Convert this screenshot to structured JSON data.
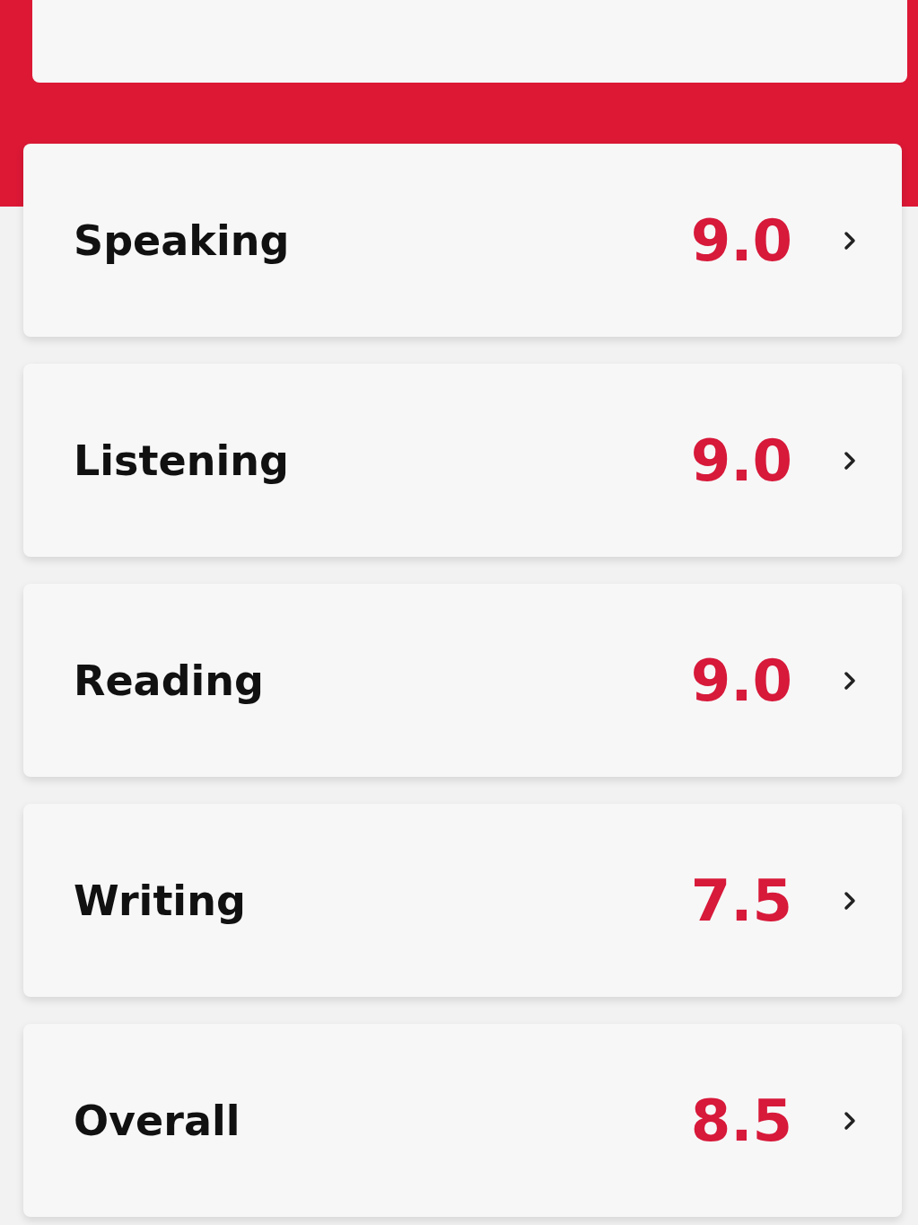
{
  "scores": [
    {
      "label": "Speaking",
      "value": "9.0"
    },
    {
      "label": "Listening",
      "value": "9.0"
    },
    {
      "label": "Reading",
      "value": "9.0"
    },
    {
      "label": "Writing",
      "value": "7.5"
    },
    {
      "label": "Overall",
      "value": "8.5"
    }
  ]
}
